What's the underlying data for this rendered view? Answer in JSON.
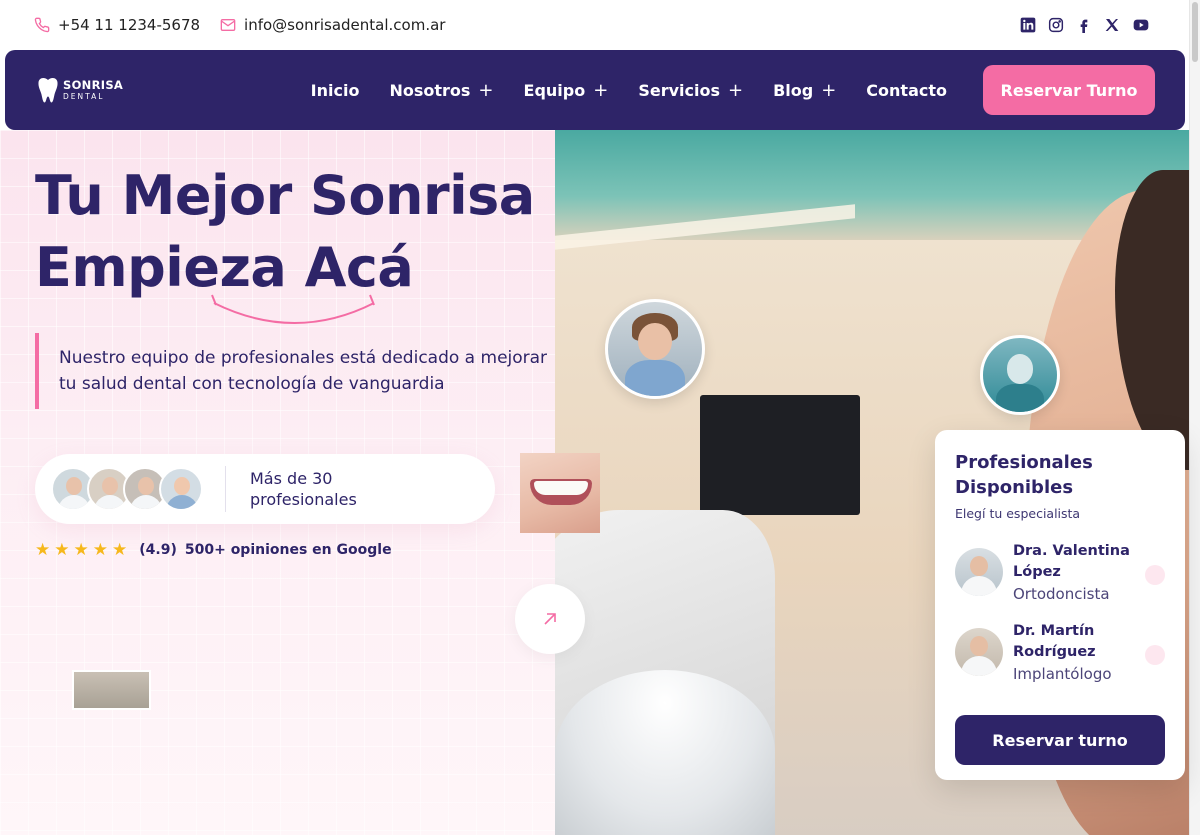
{
  "topbar": {
    "phone": "+54 11 1234-5678",
    "email": "info@sonrisadental.com.ar",
    "social": [
      "linkedin-icon",
      "instagram-icon",
      "facebook-icon",
      "x-icon",
      "youtube-icon"
    ]
  },
  "nav": {
    "logo_brand": "SONRISA",
    "logo_sub": "DENTAL",
    "items": [
      {
        "label": "Inicio",
        "has_submenu": false
      },
      {
        "label": "Nosotros",
        "has_submenu": true
      },
      {
        "label": "Equipo",
        "has_submenu": true
      },
      {
        "label": "Servicios",
        "has_submenu": true
      },
      {
        "label": "Blog",
        "has_submenu": true
      },
      {
        "label": "Contacto",
        "has_submenu": false
      }
    ],
    "cta": "Reservar Turno"
  },
  "hero": {
    "title_line1": "Tu Mejor Sonrisa",
    "title_line2": "Empieza Acá",
    "description": "Nuestro equipo de profesionales está dedicado a mejorar tu salud dental con tecnología de vanguardia",
    "pros_text": "Más de 30 profesionales",
    "rating_score": "(4.9)",
    "rating_reviews": "500+ opiniones en Google",
    "stars": 5
  },
  "card": {
    "title": "Profesionales Disponibles",
    "subtitle": "Elegí tu especialista",
    "doctors": [
      {
        "name": "Dra. Valentina López",
        "role": "Ortodoncista"
      },
      {
        "name": "Dr. Martín Rodríguez",
        "role": "Implantólogo"
      }
    ],
    "button": "Reservar turno"
  },
  "colors": {
    "primary": "#2e2468",
    "accent": "#f46ca4",
    "star": "#f6b81c"
  }
}
